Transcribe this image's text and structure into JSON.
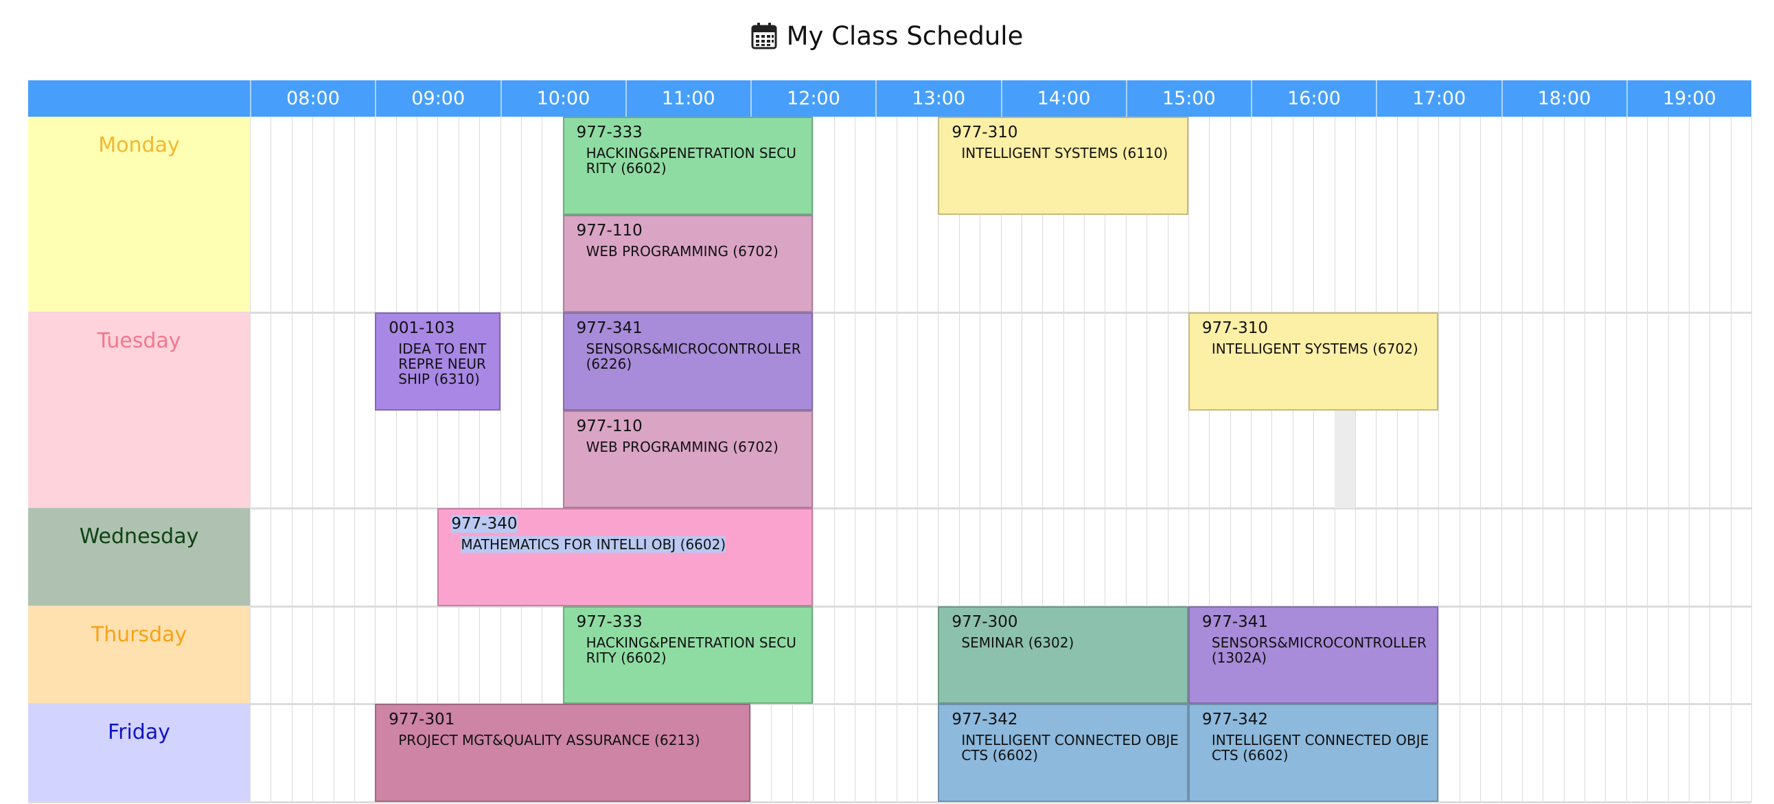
{
  "title": "My Class Schedule",
  "title_icon": "calendar-icon",
  "hours": [
    "08:00",
    "09:00",
    "10:00",
    "11:00",
    "12:00",
    "13:00",
    "14:00",
    "15:00",
    "16:00",
    "17:00",
    "18:00",
    "19:00"
  ],
  "days": [
    {
      "name": "Monday",
      "bg": "#ffffb3",
      "color": "#f4b731",
      "lanes": 2
    },
    {
      "name": "Tuesday",
      "bg": "#ffd3dc",
      "color": "#f4778d",
      "lanes": 2
    },
    {
      "name": "Wednesday",
      "bg": "#afc1b0",
      "color": "#0e4312",
      "lanes": 1
    },
    {
      "name": "Thursday",
      "bg": "#ffe1b0",
      "color": "#f6a218",
      "lanes": 1
    },
    {
      "name": "Friday",
      "bg": "#d3d3ff",
      "color": "#1015c4",
      "lanes": 1
    }
  ],
  "events": [
    {
      "day": 0,
      "lane": 0,
      "start": "10:00",
      "end": "12:00",
      "code": "977-333",
      "name": "HACKING&PENETRATION SECURITY (6602)",
      "color": "#8fdca3"
    },
    {
      "day": 0,
      "lane": 1,
      "start": "10:00",
      "end": "12:00",
      "code": "977-110",
      "name": "WEB PROGRAMMING (6702)",
      "color": "#daa4c5"
    },
    {
      "day": 0,
      "lane": 0,
      "start": "13:00",
      "end": "15:00",
      "code": "977-310",
      "name": "INTELLIGENT SYSTEMS (6110)",
      "color": "#fcefa6"
    },
    {
      "day": 1,
      "lane": 0,
      "start": "08:30",
      "end": "09:30",
      "code": "001-103",
      "name": "IDEA TO ENTREPRE NEURSHIP (6310)",
      "color": "#a887e5"
    },
    {
      "day": 1,
      "lane": 0,
      "start": "10:00",
      "end": "12:00",
      "code": "977-341",
      "name": "SENSORS&MICROCONTROLLER (6226)",
      "color": "#a88bd9"
    },
    {
      "day": 1,
      "lane": 1,
      "start": "10:00",
      "end": "12:00",
      "code": "977-110",
      "name": "WEB PROGRAMMING (6702)",
      "color": "#daa4c5"
    },
    {
      "day": 1,
      "lane": 0,
      "start": "15:00",
      "end": "17:00",
      "code": "977-310",
      "name": "INTELLIGENT SYSTEMS (6702)",
      "color": "#fcefa6"
    },
    {
      "day": 2,
      "lane": 0,
      "start": "09:00",
      "end": "12:00",
      "code": "977-340",
      "name": "MATHEMATICS FOR INTELLI OBJ (6602)",
      "color": "#fba3cf",
      "highlighted": true
    },
    {
      "day": 3,
      "lane": 0,
      "start": "10:00",
      "end": "12:00",
      "code": "977-333",
      "name": "HACKING&PENETRATION SECURITY (6602)",
      "color": "#8fdca3"
    },
    {
      "day": 3,
      "lane": 0,
      "start": "13:00",
      "end": "15:00",
      "code": "977-300",
      "name": "SEMINAR (6302)",
      "color": "#8cc1ad"
    },
    {
      "day": 3,
      "lane": 0,
      "start": "15:00",
      "end": "17:00",
      "code": "977-341",
      "name": "SENSORS&MICROCONTROLLER (1302A)",
      "color": "#a88bd9"
    },
    {
      "day": 4,
      "lane": 0,
      "start": "08:30",
      "end": "11:30",
      "code": "977-301",
      "name": "PROJECT MGT&QUALITY ASSURANCE (6213)",
      "color": "#cd84a5"
    },
    {
      "day": 4,
      "lane": 0,
      "start": "13:00",
      "end": "15:00",
      "code": "977-342",
      "name": "INTELLIGENT CONNECTED OBJECTS (6602)",
      "color": "#8db9dc"
    },
    {
      "day": 4,
      "lane": 0,
      "start": "15:00",
      "end": "17:00",
      "code": "977-342",
      "name": "INTELLIGENT CONNECTED OBJECTS (6602)",
      "color": "#8db9dc"
    }
  ],
  "hover_cell": {
    "day": 1,
    "time": "16:10"
  }
}
